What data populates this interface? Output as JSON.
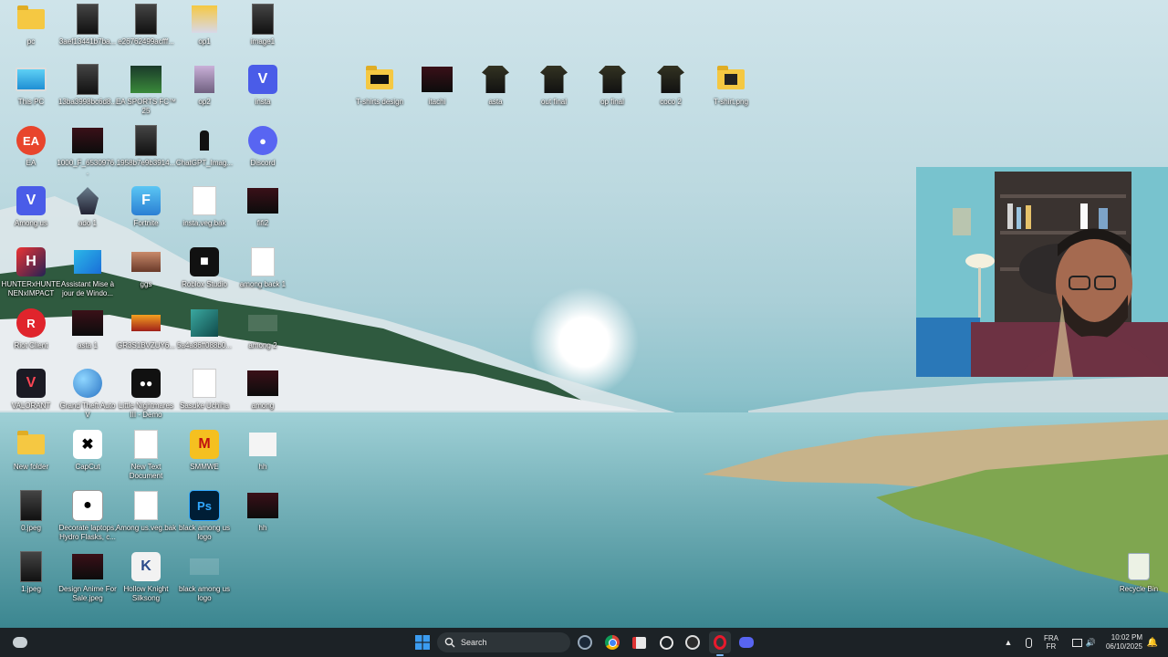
{
  "desktop": {
    "icons": [
      {
        "label": "pc",
        "kind": "folder"
      },
      {
        "label": "This PC",
        "kind": "monitor"
      },
      {
        "label": "EA",
        "kind": "ea"
      },
      {
        "label": "Among us",
        "kind": "v-blue"
      },
      {
        "label": "HUNTERxHUNTENENxIMPACT",
        "kind": "game"
      },
      {
        "label": "Riot Client",
        "kind": "riot"
      },
      {
        "label": "VALORANT",
        "kind": "valorant"
      },
      {
        "label": "New folder",
        "kind": "folder"
      },
      {
        "label": "0.jpeg",
        "kind": "thumb"
      },
      {
        "label": "1.jpeg",
        "kind": "thumb"
      },
      {
        "label": "3aef13441b7ba...",
        "kind": "thumb"
      },
      {
        "label": "13ba3998bc6d8...",
        "kind": "thumb"
      },
      {
        "label": "1000_F_6530976...",
        "kind": "dark"
      },
      {
        "label": "ado 1",
        "kind": "wings"
      },
      {
        "label": "Assistant Mise à jour de Windo...",
        "kind": "windows"
      },
      {
        "label": "asta 1",
        "kind": "dark"
      },
      {
        "label": "Grand Theft Auto V",
        "kind": "globe"
      },
      {
        "label": "CapCut",
        "kind": "capcut"
      },
      {
        "label": "Decorate laptops, Hydro Flasks, c...",
        "kind": "panda"
      },
      {
        "label": "Design Anime For Sale.jpeg",
        "kind": "dark"
      },
      {
        "label": "e26762499acfff...",
        "kind": "thumb"
      },
      {
        "label": "EA SPORTS FC™ 25",
        "kind": "fc"
      },
      {
        "label": "1958b7e9b3914...",
        "kind": "thumb"
      },
      {
        "label": "Fortnite",
        "kind": "fortnite"
      },
      {
        "label": "ggs",
        "kind": "face"
      },
      {
        "label": "GR3S1BVZUY6...",
        "kind": "fire"
      },
      {
        "label": "Little Nightmares III - Demo",
        "kind": "nightmare"
      },
      {
        "label": "New Text Document",
        "kind": "doc"
      },
      {
        "label": "Among us.veg.bak",
        "kind": "doc"
      },
      {
        "label": "Hollow Knight Silksong",
        "kind": "knight"
      },
      {
        "label": "op1",
        "kind": "anime"
      },
      {
        "label": "op2",
        "kind": "anime2"
      },
      {
        "label": "ChatGPT_Imag...",
        "kind": "figure"
      },
      {
        "label": "insta.veg.bak",
        "kind": "doc"
      },
      {
        "label": "Roblox Studio",
        "kind": "roblox"
      },
      {
        "label": "5a4a86ff088b0...",
        "kind": "phone"
      },
      {
        "label": "Sasuke Uchiha",
        "kind": "doc"
      },
      {
        "label": "SMMWE",
        "kind": "smmwe"
      },
      {
        "label": "black among us logo",
        "kind": "ps"
      },
      {
        "label": "black among us logo",
        "kind": "blank"
      },
      {
        "label": "image1",
        "kind": "thumb"
      },
      {
        "label": "insta",
        "kind": "v-blue"
      },
      {
        "label": "Discord",
        "kind": "discord"
      },
      {
        "label": "fifi2",
        "kind": "dark"
      },
      {
        "label": "among back 1",
        "kind": "doc"
      },
      {
        "label": "among 2",
        "kind": "blank"
      },
      {
        "label": "among",
        "kind": "dark"
      },
      {
        "label": "hh",
        "kind": "hh"
      },
      {
        "label": "hh",
        "kind": "dark"
      },
      {
        "label": "T-shirts design",
        "kind": "folder-dark"
      },
      {
        "label": "itachi",
        "kind": "dark"
      },
      {
        "label": "asta",
        "kind": "shirt"
      },
      {
        "label": "out final",
        "kind": "shirt"
      },
      {
        "label": "op final",
        "kind": "shirt"
      },
      {
        "label": "coco 2",
        "kind": "shirt"
      },
      {
        "label": "T-shirt.png",
        "kind": "folder-png"
      },
      {
        "label": "Recycle Bin",
        "kind": "recycle"
      }
    ]
  },
  "taskbar": {
    "search_placeholder": "Search",
    "tray": {
      "lang_top": "FRA",
      "lang_bottom": "FR",
      "time": "10:02 PM",
      "date": "06/10/2025"
    }
  },
  "colors": {
    "taskbar_bg": "#1c2226",
    "accent_windows": "#3b9cf0",
    "discord": "#5865f2",
    "ea": "#e8452c"
  }
}
